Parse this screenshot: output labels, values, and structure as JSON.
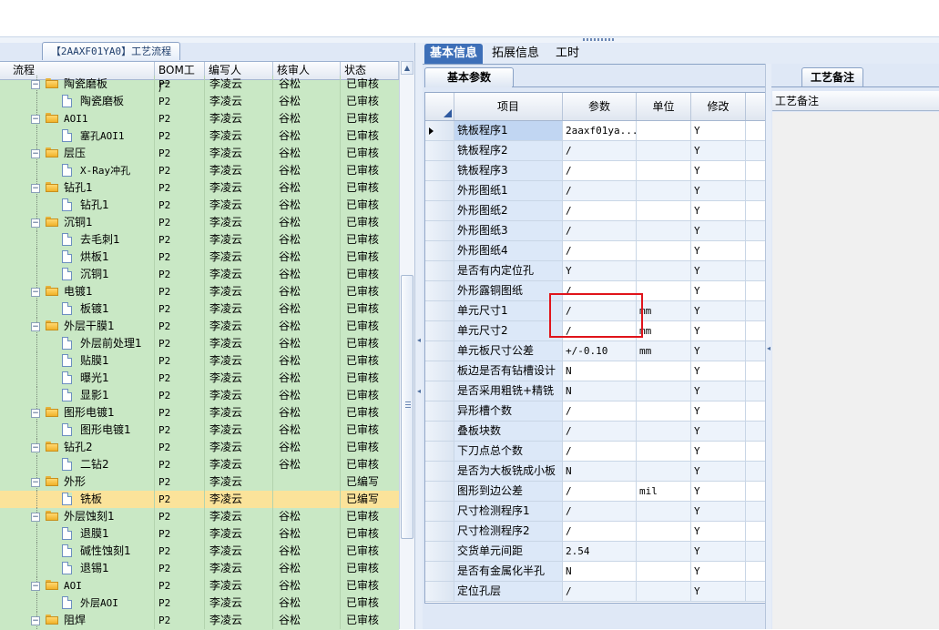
{
  "left_panel": {
    "tab_title": "【2AAXF01YA0】工艺流程",
    "columns": [
      "流程",
      "BOM工厂",
      "编写人",
      "核审人",
      "状态"
    ],
    "rows": [
      {
        "name": "陶瓷磨板",
        "level": 0,
        "type": "folder",
        "bom": "P2",
        "writer": "李凌云",
        "reviewer": "谷松",
        "status": "已审核"
      },
      {
        "name": "陶瓷磨板",
        "level": 1,
        "type": "doc",
        "bom": "P2",
        "writer": "李凌云",
        "reviewer": "谷松",
        "status": "已审核"
      },
      {
        "name": "AOI1",
        "level": 0,
        "type": "folder",
        "bom": "P2",
        "writer": "李凌云",
        "reviewer": "谷松",
        "status": "已审核"
      },
      {
        "name": "塞孔AOI1",
        "level": 1,
        "type": "doc",
        "bom": "P2",
        "writer": "李凌云",
        "reviewer": "谷松",
        "status": "已审核"
      },
      {
        "name": "层压",
        "level": 0,
        "type": "folder",
        "bom": "P2",
        "writer": "李凌云",
        "reviewer": "谷松",
        "status": "已审核"
      },
      {
        "name": "X-Ray冲孔",
        "level": 1,
        "type": "doc",
        "bom": "P2",
        "writer": "李凌云",
        "reviewer": "谷松",
        "status": "已审核"
      },
      {
        "name": "钻孔1",
        "level": 0,
        "type": "folder",
        "bom": "P2",
        "writer": "李凌云",
        "reviewer": "谷松",
        "status": "已审核"
      },
      {
        "name": "钻孔1",
        "level": 1,
        "type": "doc",
        "bom": "P2",
        "writer": "李凌云",
        "reviewer": "谷松",
        "status": "已审核"
      },
      {
        "name": "沉铜1",
        "level": 0,
        "type": "folder",
        "bom": "P2",
        "writer": "李凌云",
        "reviewer": "谷松",
        "status": "已审核"
      },
      {
        "name": "去毛刺1",
        "level": 1,
        "type": "doc",
        "bom": "P2",
        "writer": "李凌云",
        "reviewer": "谷松",
        "status": "已审核"
      },
      {
        "name": "烘板1",
        "level": 1,
        "type": "doc",
        "bom": "P2",
        "writer": "李凌云",
        "reviewer": "谷松",
        "status": "已审核"
      },
      {
        "name": "沉铜1",
        "level": 1,
        "type": "doc",
        "bom": "P2",
        "writer": "李凌云",
        "reviewer": "谷松",
        "status": "已审核"
      },
      {
        "name": "电镀1",
        "level": 0,
        "type": "folder",
        "bom": "P2",
        "writer": "李凌云",
        "reviewer": "谷松",
        "status": "已审核"
      },
      {
        "name": "板镀1",
        "level": 1,
        "type": "doc",
        "bom": "P2",
        "writer": "李凌云",
        "reviewer": "谷松",
        "status": "已审核"
      },
      {
        "name": "外层干膜1",
        "level": 0,
        "type": "folder",
        "bom": "P2",
        "writer": "李凌云",
        "reviewer": "谷松",
        "status": "已审核"
      },
      {
        "name": "外层前处理1",
        "level": 1,
        "type": "doc",
        "bom": "P2",
        "writer": "李凌云",
        "reviewer": "谷松",
        "status": "已审核"
      },
      {
        "name": "贴膜1",
        "level": 1,
        "type": "doc",
        "bom": "P2",
        "writer": "李凌云",
        "reviewer": "谷松",
        "status": "已审核"
      },
      {
        "name": "曝光1",
        "level": 1,
        "type": "doc",
        "bom": "P2",
        "writer": "李凌云",
        "reviewer": "谷松",
        "status": "已审核"
      },
      {
        "name": "显影1",
        "level": 1,
        "type": "doc",
        "bom": "P2",
        "writer": "李凌云",
        "reviewer": "谷松",
        "status": "已审核"
      },
      {
        "name": "图形电镀1",
        "level": 0,
        "type": "folder",
        "bom": "P2",
        "writer": "李凌云",
        "reviewer": "谷松",
        "status": "已审核"
      },
      {
        "name": "图形电镀1",
        "level": 1,
        "type": "doc",
        "bom": "P2",
        "writer": "李凌云",
        "reviewer": "谷松",
        "status": "已审核"
      },
      {
        "name": "钻孔2",
        "level": 0,
        "type": "folder",
        "bom": "P2",
        "writer": "李凌云",
        "reviewer": "谷松",
        "status": "已审核"
      },
      {
        "name": "二钻2",
        "level": 1,
        "type": "doc",
        "bom": "P2",
        "writer": "李凌云",
        "reviewer": "谷松",
        "status": "已审核"
      },
      {
        "name": "外形",
        "level": 0,
        "type": "folder",
        "bom": "P2",
        "writer": "李凌云",
        "reviewer": "",
        "status": "已编写"
      },
      {
        "name": "铣板",
        "level": 1,
        "type": "doc",
        "bom": "P2",
        "writer": "李凌云",
        "reviewer": "",
        "status": "已编写",
        "selected": true
      },
      {
        "name": "外层蚀刻1",
        "level": 0,
        "type": "folder",
        "bom": "P2",
        "writer": "李凌云",
        "reviewer": "谷松",
        "status": "已审核"
      },
      {
        "name": "退膜1",
        "level": 1,
        "type": "doc",
        "bom": "P2",
        "writer": "李凌云",
        "reviewer": "谷松",
        "status": "已审核"
      },
      {
        "name": "碱性蚀刻1",
        "level": 1,
        "type": "doc",
        "bom": "P2",
        "writer": "李凌云",
        "reviewer": "谷松",
        "status": "已审核"
      },
      {
        "name": "退锡1",
        "level": 1,
        "type": "doc",
        "bom": "P2",
        "writer": "李凌云",
        "reviewer": "谷松",
        "status": "已审核"
      },
      {
        "name": "AOI",
        "level": 0,
        "type": "folder",
        "bom": "P2",
        "writer": "李凌云",
        "reviewer": "谷松",
        "status": "已审核"
      },
      {
        "name": "外层AOI",
        "level": 1,
        "type": "doc",
        "bom": "P2",
        "writer": "李凌云",
        "reviewer": "谷松",
        "status": "已审核"
      },
      {
        "name": "阻焊",
        "level": 0,
        "type": "folder",
        "bom": "P2",
        "writer": "李凌云",
        "reviewer": "谷松",
        "status": "已审核"
      }
    ]
  },
  "main_tabs": [
    "基本信息",
    "拓展信息",
    "工时"
  ],
  "sub_tab": "基本参数",
  "param_grid": {
    "columns": [
      "项目",
      "参数",
      "单位",
      "修改"
    ],
    "rows": [
      {
        "item": "铣板程序1",
        "param": "2aaxf01ya...",
        "unit": "",
        "mod": "Y",
        "current": true
      },
      {
        "item": "铣板程序2",
        "param": "/",
        "unit": "",
        "mod": "Y"
      },
      {
        "item": "铣板程序3",
        "param": "/",
        "unit": "",
        "mod": "Y"
      },
      {
        "item": "外形图纸1",
        "param": "/",
        "unit": "",
        "mod": "Y"
      },
      {
        "item": "外形图纸2",
        "param": "/",
        "unit": "",
        "mod": "Y"
      },
      {
        "item": "外形图纸3",
        "param": "/",
        "unit": "",
        "mod": "Y"
      },
      {
        "item": "外形图纸4",
        "param": "/",
        "unit": "",
        "mod": "Y"
      },
      {
        "item": "是否有内定位孔",
        "param": "Y",
        "unit": "",
        "mod": "Y"
      },
      {
        "item": "外形露铜图纸",
        "param": "/",
        "unit": "",
        "mod": "Y"
      },
      {
        "item": "单元尺寸1",
        "param": "/",
        "unit": "mm",
        "mod": "Y"
      },
      {
        "item": "单元尺寸2",
        "param": "/",
        "unit": "mm",
        "mod": "Y"
      },
      {
        "item": "单元板尺寸公差",
        "param": "+/-0.10",
        "unit": "mm",
        "mod": "Y"
      },
      {
        "item": "板边是否有钻槽设计",
        "param": "N",
        "unit": "",
        "mod": "Y"
      },
      {
        "item": "是否采用粗铣+精铣",
        "param": "N",
        "unit": "",
        "mod": "Y"
      },
      {
        "item": "异形槽个数",
        "param": "/",
        "unit": "",
        "mod": "Y"
      },
      {
        "item": "叠板块数",
        "param": "/",
        "unit": "",
        "mod": "Y"
      },
      {
        "item": "下刀点总个数",
        "param": "/",
        "unit": "",
        "mod": "Y"
      },
      {
        "item": "是否为大板铣成小板",
        "param": "N",
        "unit": "",
        "mod": "Y"
      },
      {
        "item": "图形到边公差",
        "param": "/",
        "unit": "mil",
        "mod": "Y"
      },
      {
        "item": "尺寸检测程序1",
        "param": "/",
        "unit": "",
        "mod": "Y"
      },
      {
        "item": "尺寸检测程序2",
        "param": "/",
        "unit": "",
        "mod": "Y"
      },
      {
        "item": "交货单元间距",
        "param": "2.54",
        "unit": "",
        "mod": "Y"
      },
      {
        "item": "是否有金属化半孔",
        "param": "N",
        "unit": "",
        "mod": "Y"
      },
      {
        "item": "定位孔层",
        "param": "/",
        "unit": "",
        "mod": "Y"
      }
    ]
  },
  "notes_panel": {
    "tab": "工艺备注",
    "header": "工艺备注"
  },
  "colors": {
    "tree_bg": "#c9e8c5",
    "selected_row": "#fbe39a",
    "active_tab": "#3d6fb8",
    "highlight_box": "#e0141b"
  }
}
